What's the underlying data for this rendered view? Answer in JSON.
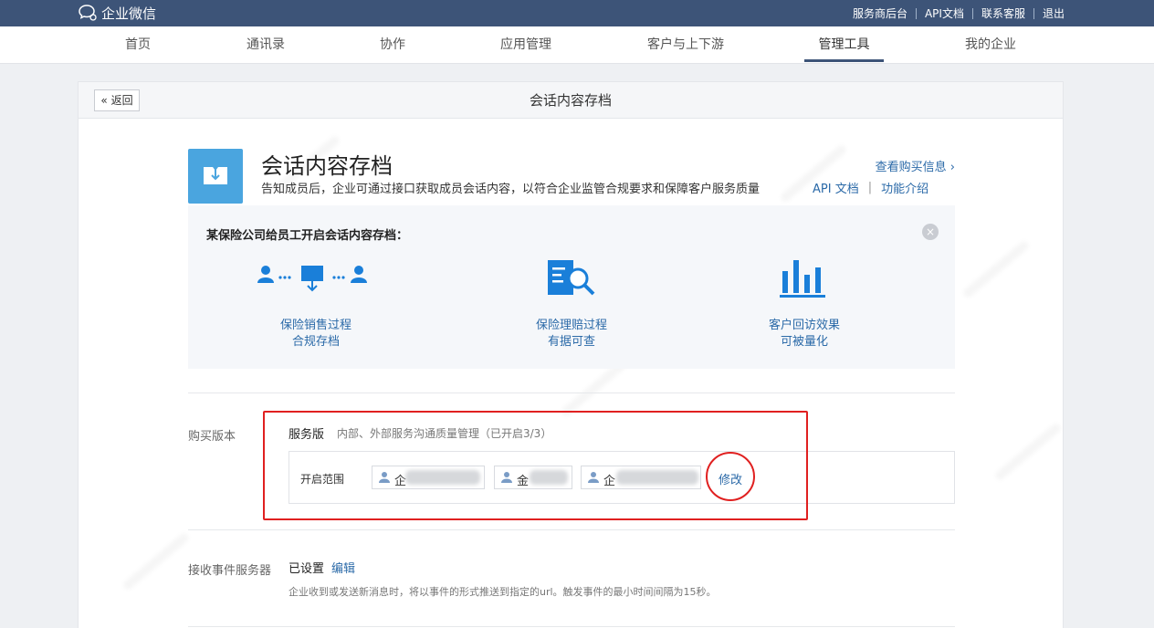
{
  "topbar": {
    "logo_text": "企业微信",
    "links": [
      "服务商后台",
      "API文档",
      "联系客服",
      "退出"
    ]
  },
  "nav": {
    "items": [
      "首页",
      "通讯录",
      "协作",
      "应用管理",
      "客户与上下游",
      "管理工具",
      "我的企业"
    ],
    "active": "管理工具"
  },
  "page": {
    "back_label": "« 返回",
    "title": "会话内容存档"
  },
  "app": {
    "icon": "archive-download-icon",
    "name": "会话内容存档",
    "description": "告知成员后，企业可通过接口获取成员会话内容，以符合企业监管合规要求和保障客户服务质量",
    "buy_info": "查看购买信息 ›",
    "api_doc": "API 文档",
    "link_sep": "|",
    "feature_intro": "功能介绍"
  },
  "example": {
    "title": "某保险公司给员工开启会话内容存档：",
    "features": [
      {
        "icon": "user-transfer-archive-icon",
        "line1": "保险销售过程",
        "line2": "合规存档"
      },
      {
        "icon": "document-search-icon",
        "line1": "保险理赔过程",
        "line2": "有据可查"
      },
      {
        "icon": "bar-chart-icon",
        "line1": "客户回访效果",
        "line2": "可被量化"
      }
    ]
  },
  "purchase": {
    "label": "购买版本",
    "version_name": "服务版",
    "version_desc": "内部、外部服务沟通质量管理（已开启3/3）",
    "scope_label": "开启范围",
    "tags": [
      "企",
      "金",
      "企"
    ],
    "modify_label": "修改"
  },
  "event_server": {
    "label": "接收事件服务器",
    "status": "已设置",
    "edit_label": "编辑",
    "description": "企业收到或发送新消息时，将以事件的形式推送到指定的url。触发事件的最小时间间隔为15秒。"
  },
  "colors": {
    "topbar": "#3d5478",
    "link": "#2b6aa8",
    "accent_blue": "#1a7fd9",
    "highlight_red": "#e02020"
  }
}
